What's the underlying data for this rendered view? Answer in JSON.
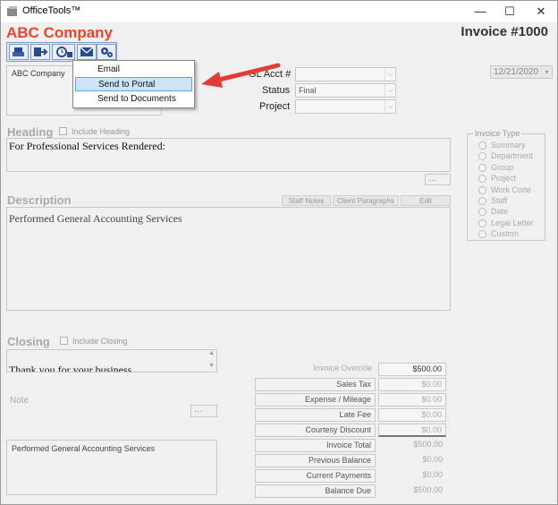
{
  "window": {
    "title": "OfficeTools™",
    "min": "—",
    "max": "☐",
    "close": "✕"
  },
  "header": {
    "company": "ABC Company",
    "invoice": "Invoice #1000"
  },
  "client_box": {
    "text": "ABC Company"
  },
  "menu": {
    "items": [
      "Email",
      "Send to Portal",
      "Send to Documents"
    ]
  },
  "fields": {
    "gl_label": "GL Acct #",
    "gl_value": "",
    "status_label": "Status",
    "status_value": "Final",
    "project_label": "Project",
    "project_value": "",
    "date": "12/21/2020"
  },
  "heading": {
    "title": "Heading",
    "include": "Include Heading",
    "text": "For Professional Services Rendered:",
    "more": "..."
  },
  "description": {
    "title": "Description",
    "text": "Performed General Accounting Services",
    "buttons": [
      "Staff Notes",
      "Client Paragraphs",
      "Edit"
    ]
  },
  "invoice_type": {
    "title": "Invoice Type",
    "options": [
      "Summary",
      "Department",
      "Group",
      "Project",
      "Work Code",
      "Staff",
      "Date",
      "Legal Letter",
      "Custom"
    ]
  },
  "closing": {
    "title": "Closing",
    "include": "Include Closing",
    "text": "Thank you for your business."
  },
  "note": {
    "title": "Note",
    "more": "...",
    "text": "Performed General Accounting Services"
  },
  "summary": [
    {
      "label": "Invoice Override",
      "value": "$500.00"
    },
    {
      "label": "Sales Tax",
      "value": "$0.00"
    },
    {
      "label": "Expense / Mileage",
      "value": "$0.00"
    },
    {
      "label": "Late Fee",
      "value": "$0.00"
    },
    {
      "label": "Courtesy Discount",
      "value": "$0.00"
    },
    {
      "label": "Invoice Total",
      "value": "$500.00"
    },
    {
      "label": "Previous Balance",
      "value": "$0.00"
    },
    {
      "label": "Current Payments",
      "value": "$0.00"
    },
    {
      "label": "Balance Due",
      "value": "$500.00"
    }
  ]
}
